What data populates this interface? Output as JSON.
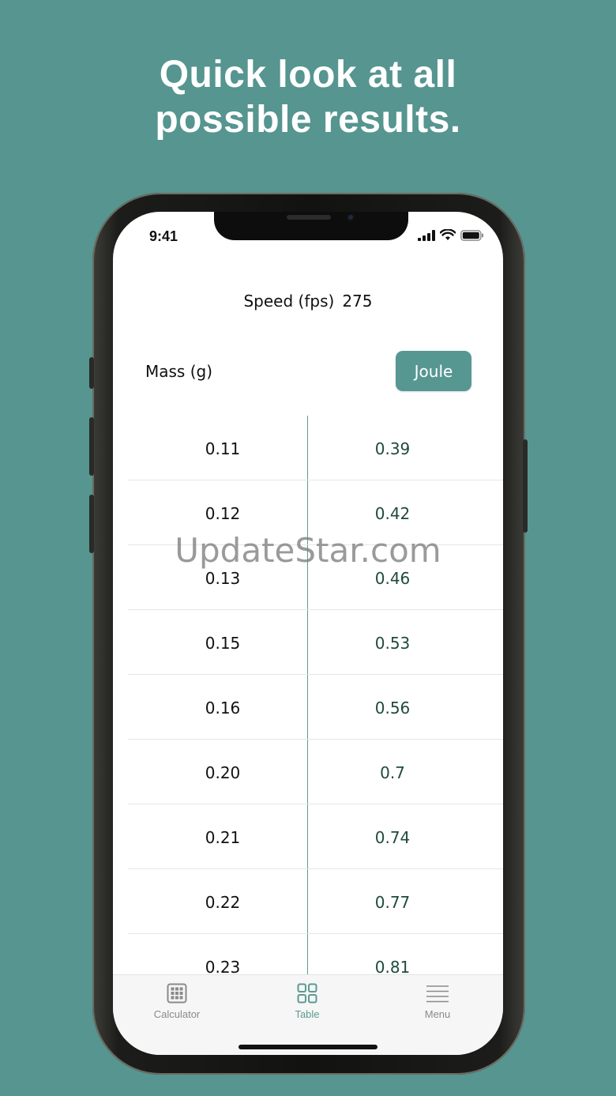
{
  "headline": {
    "line1": "Quick look at all",
    "line2": "possible results."
  },
  "status_bar": {
    "time": "9:41",
    "icons": [
      "signal-icon",
      "wifi-icon",
      "battery-icon"
    ]
  },
  "speed": {
    "label": "Speed (fps)",
    "value": "275"
  },
  "table_header": {
    "mass_label": "Mass (g)",
    "unit_button": "Joule"
  },
  "rows": [
    {
      "mass": "0.11",
      "joule": "0.39"
    },
    {
      "mass": "0.12",
      "joule": "0.42"
    },
    {
      "mass": "0.13",
      "joule": "0.46"
    },
    {
      "mass": "0.15",
      "joule": "0.53"
    },
    {
      "mass": "0.16",
      "joule": "0.56"
    },
    {
      "mass": "0.20",
      "joule": "0.7"
    },
    {
      "mass": "0.21",
      "joule": "0.74"
    },
    {
      "mass": "0.22",
      "joule": "0.77"
    },
    {
      "mass": "0.23",
      "joule": "0.81"
    }
  ],
  "tabs": [
    {
      "label": "Calculator",
      "icon": "calculator-icon",
      "active": false
    },
    {
      "label": "Table",
      "icon": "table-icon",
      "active": true
    },
    {
      "label": "Menu",
      "icon": "menu-icon",
      "active": false
    }
  ],
  "watermark": "UpdateStar.com",
  "colors": {
    "background": "#569590",
    "accent": "#579792",
    "value_text": "#1f4a3e"
  }
}
